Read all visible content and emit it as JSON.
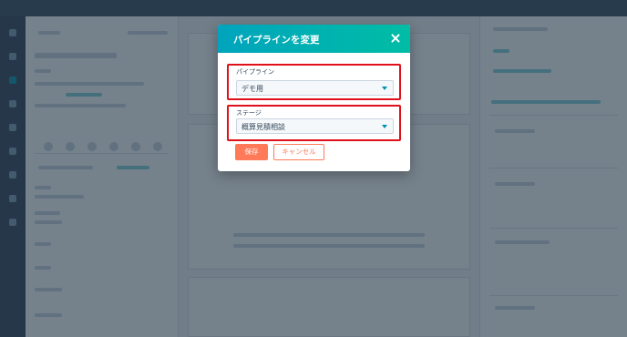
{
  "modal": {
    "title": "パイプラインを変更",
    "pipeline": {
      "label": "パイプライン",
      "value": "デモ用"
    },
    "stage": {
      "label": "ステージ",
      "value": "概算見積相談"
    },
    "save_label": "保存",
    "cancel_label": "キャンセル"
  },
  "colors": {
    "header_start": "#00a4bd",
    "header_end": "#00bda5",
    "highlight": "#e0101a",
    "primary": "#ff7a59"
  },
  "icons": [
    "close-icon",
    "chevron-down-icon"
  ]
}
